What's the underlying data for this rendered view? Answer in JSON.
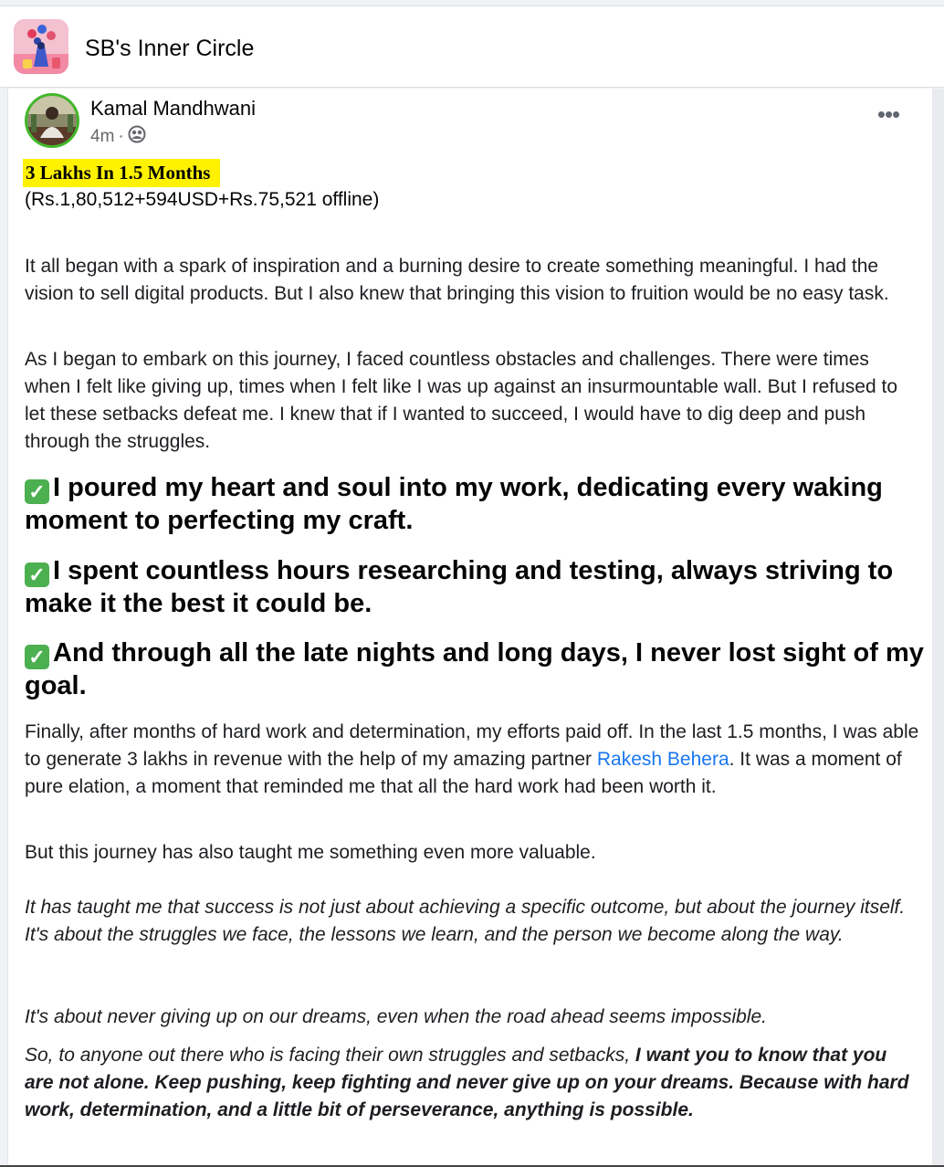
{
  "group": {
    "name": "SB's Inner Circle",
    "avatar_icon": "group-cover-icon"
  },
  "post": {
    "author": "Kamal Mandhwani",
    "time": "4m",
    "separator": "·",
    "audience_icon": "group-members-icon",
    "more_icon": "more-options-icon",
    "more_label": "•••",
    "headline": "3 Lakhs In 1.5 Months",
    "amounts": "(Rs.1,80,512+594USD+Rs.75,521 offline)",
    "para1": "It all began with a spark of inspiration and a burning desire to create something meaningful. I had the vision to sell digital products. But I also knew that bringing this vision to fruition would be no easy task.",
    "para2": "As I began to embark on this journey, I faced countless obstacles and challenges. There were times when I felt like giving up, times when I felt like I was up against an insurmountable wall. But I refused to let these setbacks defeat me. I knew that if I wanted to succeed, I would have to dig deep and push through the struggles.",
    "checkmark": "✓",
    "bullet1": "I poured my heart and soul into my work, dedicating every waking moment to perfecting my craft.",
    "bullet2": "I spent countless hours researching and testing, always striving to make it the best it could be.",
    "bullet3": "And through all the late nights and long days, I never lost sight of my goal.",
    "para3_before": "Finally, after months of hard work and determination, my efforts paid off. In the last 1.5 months, I was able to generate 3 lakhs in revenue with the help of my amazing partner ",
    "mention": "Rakesh Behera",
    "para3_after": ". It was a moment of pure elation, a moment that reminded me that all the hard work had been worth it.",
    "para4": "But this journey has also taught me something even more valuable.",
    "para5": "It has taught me that success is not just about achieving a specific outcome, but about the journey itself. It's about the struggles we face, the lessons we learn, and the person we become along the way.",
    "para6": "It's about never giving up on our dreams, even when the road ahead seems impossible.",
    "para7_before": "So, to anyone out there who is facing their own struggles and setbacks, ",
    "para7_bold": "I want you to know that you are not alone. Keep pushing, keep fighting and never give up on your dreams. Because with hard work, determination, and a little bit of perseverance, anything is possible."
  },
  "colors": {
    "highlight": "#fff200",
    "mention": "#1877f2",
    "check": "#4cb050",
    "avatar_ring": "#42b72a"
  }
}
